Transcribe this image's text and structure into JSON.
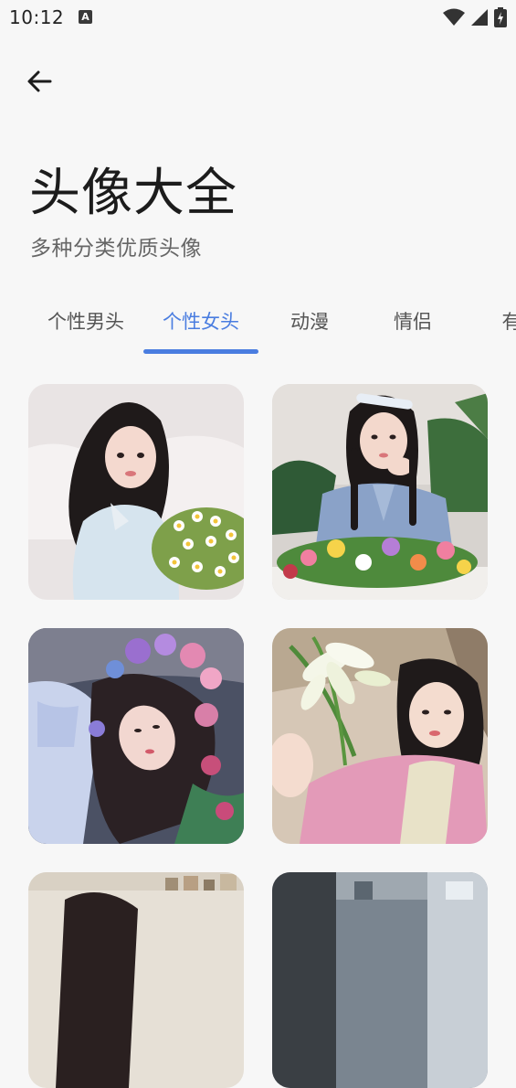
{
  "status_bar": {
    "time": "10:12",
    "notification_badge": "A",
    "icons": [
      "wifi-icon",
      "cell-signal-icon",
      "battery-charging-icon"
    ]
  },
  "header": {
    "title": "头像大全",
    "subtitle": "多种分类优质头像"
  },
  "tabs": [
    {
      "label": "个性男头",
      "active": false
    },
    {
      "label": "个性女头",
      "active": true
    },
    {
      "label": "动漫",
      "active": false
    },
    {
      "label": "情侣",
      "active": false
    },
    {
      "label": "有",
      "active": false
    }
  ],
  "colors": {
    "accent": "#4a7de0",
    "background": "#f7f7f7",
    "title_text": "#1c1c1c",
    "subtitle_text": "#666666"
  }
}
